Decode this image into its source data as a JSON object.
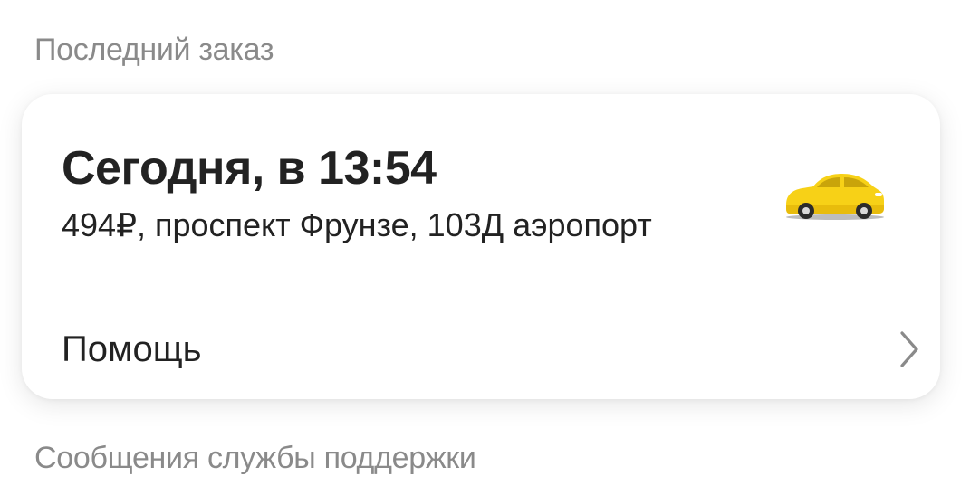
{
  "sections": {
    "last_order_title": "Последний заказ",
    "support_messages_title": "Сообщения службы поддержки"
  },
  "order": {
    "date_time": "Сегодня, в 13:54",
    "details": "494₽, проспект Фрунзе, 103Д аэропорт",
    "icon": "yellow-taxi-car-icon",
    "colors": {
      "car_body": "#f7d117",
      "car_window": "#c9a40a"
    }
  },
  "help": {
    "label": "Помощь",
    "icon": "chevron-right-icon"
  }
}
